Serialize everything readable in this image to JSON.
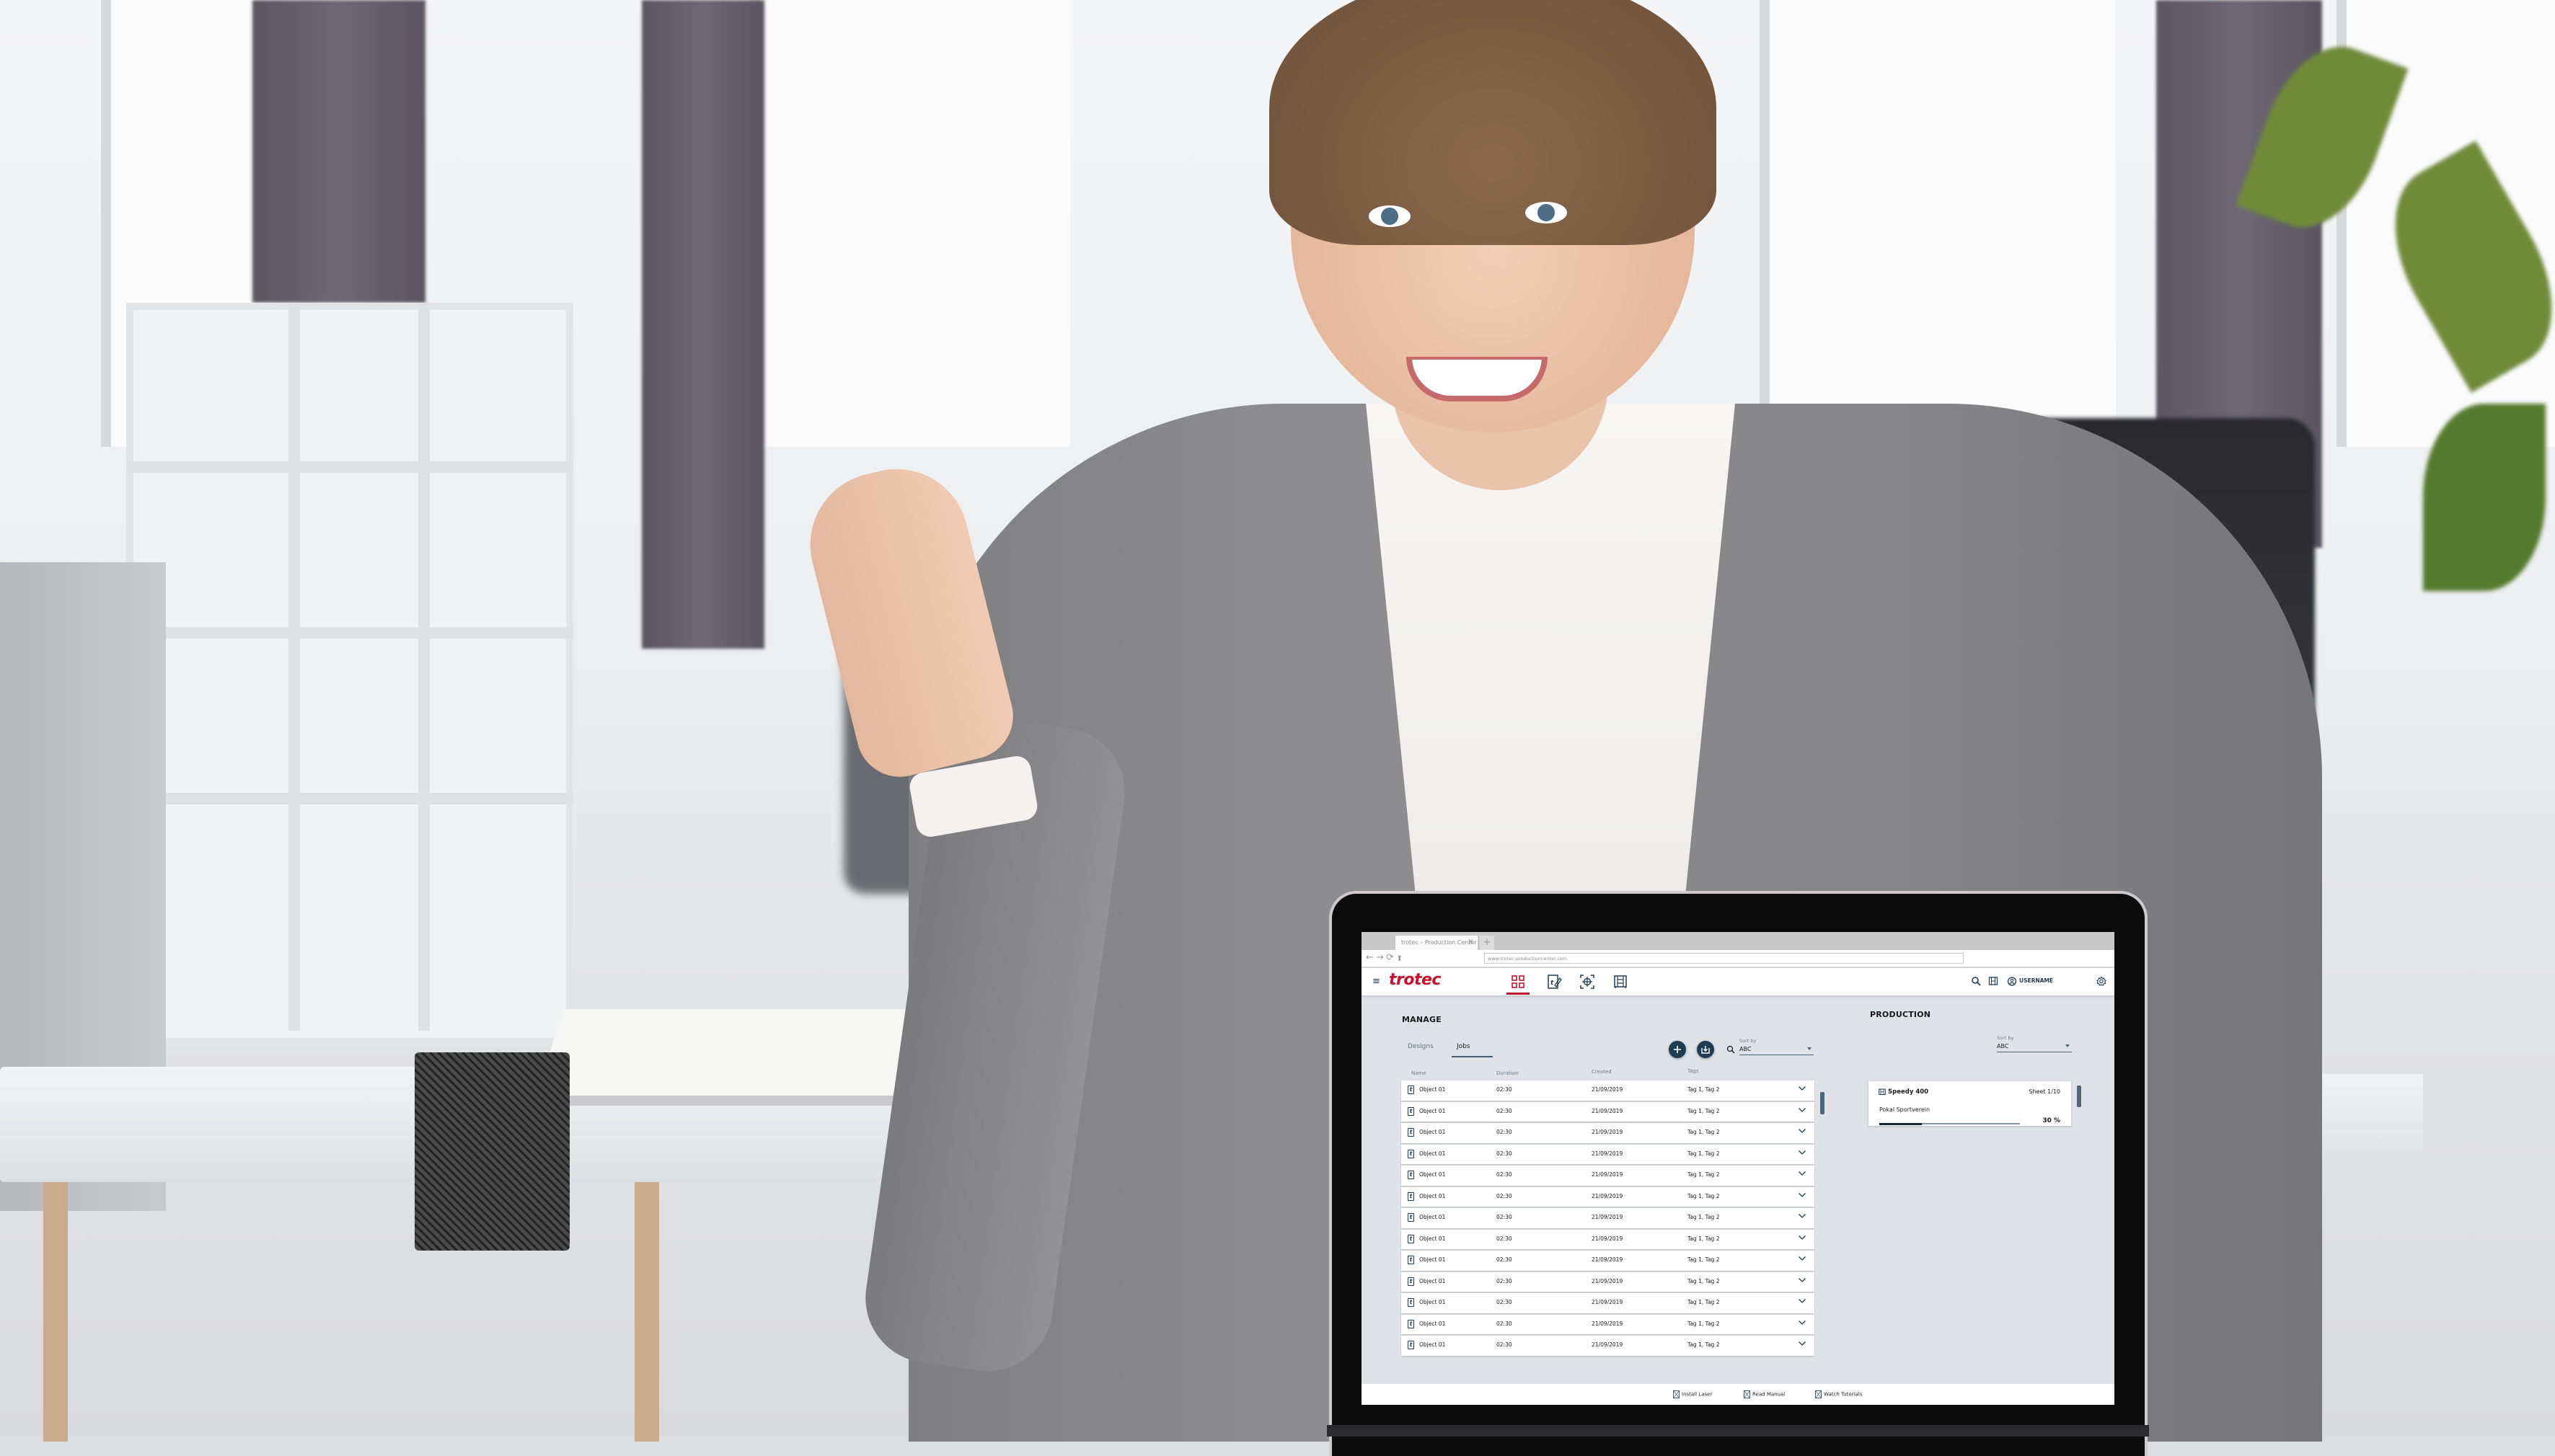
{
  "browser": {
    "tab_title": "trotec – Production Center",
    "tab_close": "X",
    "new_tab": "+",
    "nav": {
      "back": "←",
      "forward": "→",
      "reload": "⟳",
      "home": "⬆"
    },
    "url": "www.trotec-productioncenter.com"
  },
  "app": {
    "logo": "trotec",
    "menu_icon": "≡",
    "brand_color": "#c8102e",
    "primary_color": "#1e3d52",
    "nav_tabs": [
      {
        "name": "dashboard",
        "icon": "grid-icon",
        "active": true
      },
      {
        "name": "design",
        "icon": "edit-design-icon",
        "active": false
      },
      {
        "name": "position",
        "icon": "crosshair-target-icon",
        "active": false
      },
      {
        "name": "machines",
        "icon": "laser-machine-icon",
        "active": false
      }
    ],
    "header_right": {
      "search_icon": "search-icon",
      "machine_icon": "laser-machine-icon",
      "user_icon": "user-circle-icon",
      "username": "USERNAME",
      "settings_icon": "gear-icon"
    }
  },
  "manage": {
    "title": "MANAGE",
    "tabs": [
      {
        "label": "Designs",
        "active": false
      },
      {
        "label": "Jobs",
        "active": true
      }
    ],
    "add_button_icon": "plus-icon",
    "import_button_icon": "download-tray-icon",
    "sort_label": "Sort by",
    "sort_value": "ABC",
    "columns": [
      "Name",
      "Duration",
      "Created",
      "Tags"
    ],
    "rows": [
      {
        "name": "Object 01",
        "duration": "02:30",
        "created": "21/09/2019",
        "tags": "Tag 1, Tag 2"
      },
      {
        "name": "Object 01",
        "duration": "02:30",
        "created": "21/09/2019",
        "tags": "Tag 1, Tag 2"
      },
      {
        "name": "Object 01",
        "duration": "02:30",
        "created": "21/09/2019",
        "tags": "Tag 1, Tag 2"
      },
      {
        "name": "Object 01",
        "duration": "02:30",
        "created": "21/09/2019",
        "tags": "Tag 1, Tag 2"
      },
      {
        "name": "Object 01",
        "duration": "02:30",
        "created": "21/09/2019",
        "tags": "Tag 1, Tag 2"
      },
      {
        "name": "Object 01",
        "duration": "02:30",
        "created": "21/09/2019",
        "tags": "Tag 1, Tag 2"
      },
      {
        "name": "Object 01",
        "duration": "02:30",
        "created": "21/09/2019",
        "tags": "Tag 1, Tag 2"
      },
      {
        "name": "Object 01",
        "duration": "02:30",
        "created": "21/09/2019",
        "tags": "Tag 1, Tag 2"
      },
      {
        "name": "Object 01",
        "duration": "02:30",
        "created": "21/09/2019",
        "tags": "Tag 1, Tag 2"
      },
      {
        "name": "Object 01",
        "duration": "02:30",
        "created": "21/09/2019",
        "tags": "Tag 1, Tag 2"
      },
      {
        "name": "Object 01",
        "duration": "02:30",
        "created": "21/09/2019",
        "tags": "Tag 1, Tag 2"
      },
      {
        "name": "Object 01",
        "duration": "02:30",
        "created": "21/09/2019",
        "tags": "Tag 1, Tag 2"
      },
      {
        "name": "Object 01",
        "duration": "02:30",
        "created": "21/09/2019",
        "tags": "Tag 1, Tag 2"
      }
    ],
    "row_icon": "t"
  },
  "production": {
    "title": "PRODUCTION",
    "sort_label": "Sort by",
    "sort_value": "ABC",
    "card": {
      "machine": "Speedy 400",
      "sheet": "Sheet 1/10",
      "job": "Pokal Sportverein",
      "progress_percent": 30,
      "progress_label": "30 %"
    }
  },
  "footer": {
    "links": [
      "Install Laser",
      "Read Manual",
      "Watch Tutorials"
    ]
  }
}
